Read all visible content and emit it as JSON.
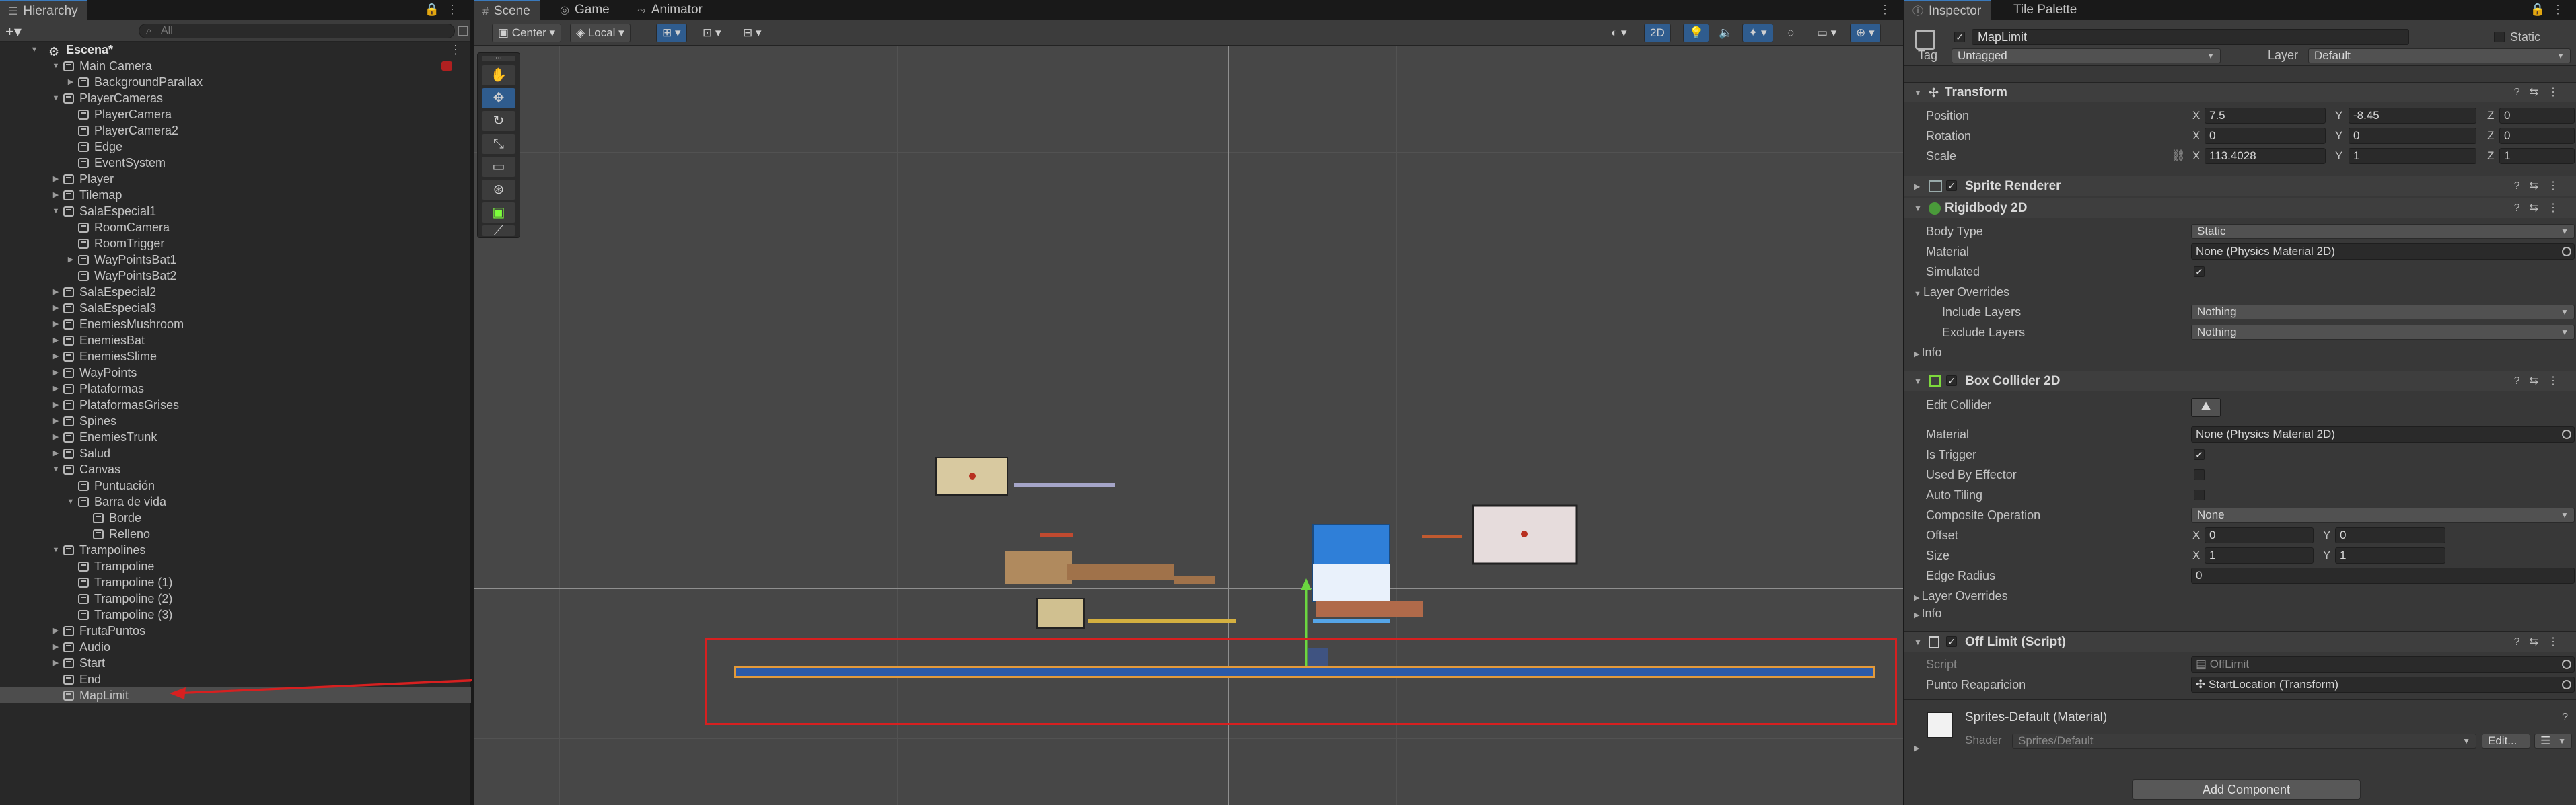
{
  "hierarchy": {
    "tab_label": "Hierarchy",
    "search_placeholder": "All",
    "items": [
      {
        "label": "Escena*",
        "depth": 0,
        "expand": "open",
        "kind": "scene"
      },
      {
        "label": "Main Camera",
        "depth": 1,
        "expand": "open"
      },
      {
        "label": "BackgroundParallax",
        "depth": 2,
        "expand": "closed"
      },
      {
        "label": "PlayerCameras",
        "depth": 1,
        "expand": "open"
      },
      {
        "label": "PlayerCamera",
        "depth": 2,
        "expand": "none"
      },
      {
        "label": "PlayerCamera2",
        "depth": 2,
        "expand": "none"
      },
      {
        "label": "Edge",
        "depth": 2,
        "expand": "none"
      },
      {
        "label": "EventSystem",
        "depth": 2,
        "expand": "none"
      },
      {
        "label": "Player",
        "depth": 1,
        "expand": "closed"
      },
      {
        "label": "Tilemap",
        "depth": 1,
        "expand": "closed"
      },
      {
        "label": "SalaEspecial1",
        "depth": 1,
        "expand": "open"
      },
      {
        "label": "RoomCamera",
        "depth": 2,
        "expand": "none"
      },
      {
        "label": "RoomTrigger",
        "depth": 2,
        "expand": "none"
      },
      {
        "label": "WayPointsBat1",
        "depth": 2,
        "expand": "closed"
      },
      {
        "label": "WayPointsBat2",
        "depth": 2,
        "expand": "none"
      },
      {
        "label": "SalaEspecial2",
        "depth": 1,
        "expand": "closed"
      },
      {
        "label": "SalaEspecial3",
        "depth": 1,
        "expand": "closed"
      },
      {
        "label": "EnemiesMushroom",
        "depth": 1,
        "expand": "closed"
      },
      {
        "label": "EnemiesBat",
        "depth": 1,
        "expand": "closed"
      },
      {
        "label": "EnemiesSlime",
        "depth": 1,
        "expand": "closed"
      },
      {
        "label": "WayPoints",
        "depth": 1,
        "expand": "closed"
      },
      {
        "label": "Plataformas",
        "depth": 1,
        "expand": "closed"
      },
      {
        "label": "PlataformasGrises",
        "depth": 1,
        "expand": "closed"
      },
      {
        "label": "Spines",
        "depth": 1,
        "expand": "closed"
      },
      {
        "label": "EnemiesTrunk",
        "depth": 1,
        "expand": "closed"
      },
      {
        "label": "Salud",
        "depth": 1,
        "expand": "closed"
      },
      {
        "label": "Canvas",
        "depth": 1,
        "expand": "open"
      },
      {
        "label": "Puntuación",
        "depth": 2,
        "expand": "none"
      },
      {
        "label": "Barra de vida",
        "depth": 2,
        "expand": "open"
      },
      {
        "label": "Borde",
        "depth": 3,
        "expand": "none"
      },
      {
        "label": "Relleno",
        "depth": 3,
        "expand": "none"
      },
      {
        "label": "Trampolines",
        "depth": 1,
        "expand": "open"
      },
      {
        "label": "Trampoline",
        "depth": 2,
        "expand": "none"
      },
      {
        "label": "Trampoline (1)",
        "depth": 2,
        "expand": "none"
      },
      {
        "label": "Trampoline (2)",
        "depth": 2,
        "expand": "none"
      },
      {
        "label": "Trampoline (3)",
        "depth": 2,
        "expand": "none"
      },
      {
        "label": "FrutaPuntos",
        "depth": 1,
        "expand": "closed"
      },
      {
        "label": "Audio",
        "depth": 1,
        "expand": "closed"
      },
      {
        "label": "Start",
        "depth": 1,
        "expand": "closed"
      },
      {
        "label": "End",
        "depth": 1,
        "expand": "none"
      },
      {
        "label": "MapLimit",
        "depth": 1,
        "expand": "none",
        "selected": true
      }
    ]
  },
  "scene": {
    "tabs": [
      "Scene",
      "Game",
      "Animator"
    ],
    "pivot_label": "Center",
    "space_label": "Local",
    "mode_2d_label": "2D"
  },
  "inspector": {
    "tabs": [
      "Inspector",
      "Tile Palette"
    ],
    "object_name": "MapLimit",
    "static_label": "Static",
    "tag_label": "Tag",
    "tag_value": "Untagged",
    "layer_label": "Layer",
    "layer_value": "Default",
    "transform": {
      "title": "Transform",
      "position_label": "Position",
      "rotation_label": "Rotation",
      "scale_label": "Scale",
      "position": {
        "x": "7.5",
        "y": "-8.45",
        "z": "0"
      },
      "rotation": {
        "x": "0",
        "y": "0",
        "z": "0"
      },
      "scale": {
        "x": "113.4028",
        "y": "1",
        "z": "1"
      }
    },
    "sprite_renderer": {
      "title": "Sprite Renderer"
    },
    "rigidbody": {
      "title": "Rigidbody 2D",
      "body_type_label": "Body Type",
      "body_type": "Static",
      "material_label": "Material",
      "material": "None (Physics Material 2D)",
      "simulated_label": "Simulated",
      "layer_overrides_label": "Layer Overrides",
      "include_layers_label": "Include Layers",
      "include_layers": "Nothing",
      "exclude_layers_label": "Exclude Layers",
      "exclude_layers": "Nothing",
      "info_label": "Info"
    },
    "box_collider": {
      "title": "Box Collider 2D",
      "edit_collider_label": "Edit Collider",
      "material_label": "Material",
      "material": "None (Physics Material 2D)",
      "is_trigger_label": "Is Trigger",
      "used_by_effector_label": "Used By Effector",
      "auto_tiling_label": "Auto Tiling",
      "composite_label": "Composite Operation",
      "composite": "None",
      "offset_label": "Offset",
      "offset": {
        "x": "0",
        "y": "0"
      },
      "size_label": "Size",
      "size": {
        "x": "1",
        "y": "1"
      },
      "edge_radius_label": "Edge Radius",
      "edge_radius": "0",
      "layer_overrides_label": "Layer Overrides",
      "info_label": "Info"
    },
    "script": {
      "title": "Off Limit (Script)",
      "script_label": "Script",
      "script_value": "OffLimit",
      "punto_label": "Punto Reaparicion",
      "punto_value": "StartLocation (Transform)"
    },
    "material": {
      "title": "Sprites-Default (Material)",
      "shader_label": "Shader",
      "shader_value": "Sprites/Default",
      "edit_label": "Edit..."
    },
    "add_component_label": "Add Component"
  },
  "colors": {
    "selection_outline": "#d72020",
    "bar_fill": "#2c5aa8",
    "bar_border": "#e39a3a",
    "accent_blue": "#2f5c8e"
  }
}
